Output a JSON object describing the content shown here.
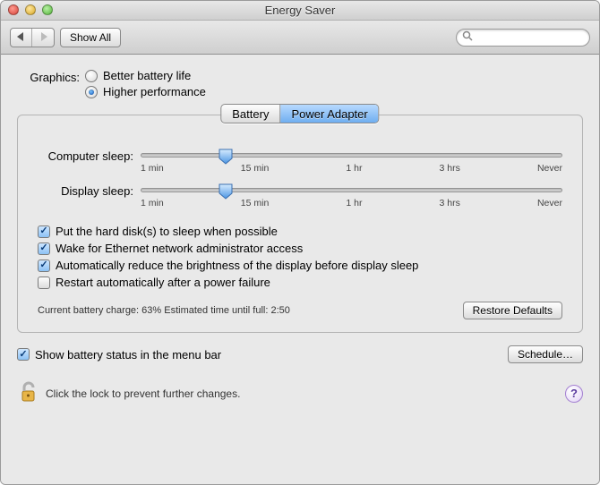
{
  "window": {
    "title": "Energy Saver"
  },
  "toolbar": {
    "show_all": "Show All",
    "search_placeholder": ""
  },
  "graphics": {
    "label": "Graphics:",
    "options": [
      "Better battery life",
      "Higher performance"
    ],
    "selected": 1
  },
  "tabs": {
    "items": [
      "Battery",
      "Power Adapter"
    ],
    "active": 1
  },
  "sliders": {
    "computer": {
      "label": "Computer sleep:",
      "position_pct": 20
    },
    "display": {
      "label": "Display sleep:",
      "position_pct": 20
    },
    "ticks": [
      "1 min",
      "15 min",
      "1 hr",
      "3 hrs",
      "Never"
    ]
  },
  "checks": {
    "hd_sleep": {
      "label": "Put the hard disk(s) to sleep when possible",
      "checked": true
    },
    "wake_enet": {
      "label": "Wake for Ethernet network administrator access",
      "checked": true
    },
    "dim_before": {
      "label": "Automatically reduce the brightness of the display before display sleep",
      "checked": true
    },
    "restart_pf": {
      "label": "Restart automatically after a power failure",
      "checked": false
    }
  },
  "status": {
    "text": "Current battery charge: 63%  Estimated time until full: 2:50",
    "restore_defaults": "Restore Defaults"
  },
  "menu_bar": {
    "show_status": {
      "label": "Show battery status in the menu bar",
      "checked": true
    },
    "schedule": "Schedule…"
  },
  "lock": {
    "text": "Click the lock to prevent further changes."
  }
}
